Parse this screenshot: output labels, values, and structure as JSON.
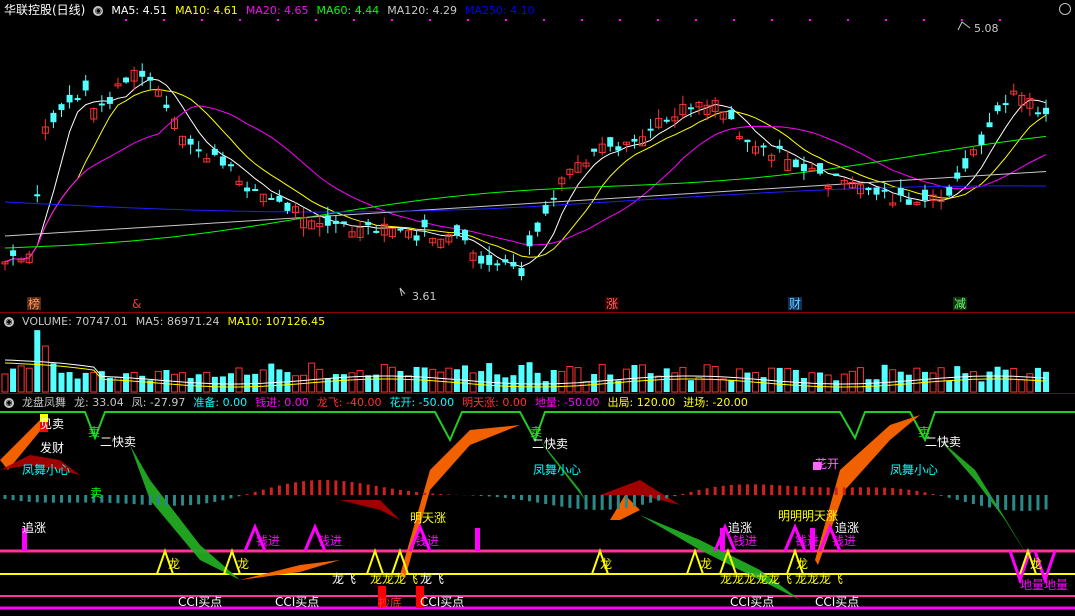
{
  "main_header": {
    "title": "华联控股(日线)",
    "items": [
      {
        "label": "MA5: 4.51",
        "color": "#ffffff"
      },
      {
        "label": "MA10: 4.61",
        "color": "#ffff00"
      },
      {
        "label": "MA20: 4.65",
        "color": "#ff00ff"
      },
      {
        "label": "MA60: 4.44",
        "color": "#00ff00"
      },
      {
        "label": "MA120: 4.29",
        "color": "#c8c8c8"
      },
      {
        "label": "MA250: 4.10",
        "color": "#0000ff"
      }
    ]
  },
  "volume_header": {
    "items": [
      {
        "label": "VOLUME: 70747.01",
        "color": "#c8c8c8"
      },
      {
        "label": "MA5: 86971.24",
        "color": "#c8c8c8"
      },
      {
        "label": "MA10: 107126.45",
        "color": "#ffff00"
      }
    ]
  },
  "indicator_header": {
    "items": [
      {
        "label": "龙盘凤舞",
        "color": "#c8c8c8"
      },
      {
        "label": "龙: 33.04",
        "color": "#c8c8c8"
      },
      {
        "label": "凤: -27.97",
        "color": "#c8c8c8"
      },
      {
        "label": "准备: 0.00",
        "color": "#00ffff"
      },
      {
        "label": "钱进: 0.00",
        "color": "#ff00ff"
      },
      {
        "label": "龙飞: -40.00",
        "color": "#ff3333"
      },
      {
        "label": "花开: -50.00",
        "color": "#00ffff"
      },
      {
        "label": "明天涨: 0.00",
        "color": "#ff3333"
      },
      {
        "label": "地量: -50.00",
        "color": "#ff00ff"
      },
      {
        "label": "出局: 120.00",
        "color": "#ffff00"
      },
      {
        "label": "进场: -20.00",
        "color": "#ffff00"
      }
    ]
  },
  "chart_data": [
    {
      "type": "candlestick",
      "title": "华联控股(日线)",
      "high_label": "5.08",
      "low_label": "3.61",
      "events": [
        {
          "text": "榜",
          "color": "#ff9966",
          "bg": "#5a2a10"
        },
        {
          "text": "&",
          "color": "#ff3333",
          "bg": ""
        },
        {
          "text": "涨",
          "color": "#ff6666",
          "bg": "#3a0000"
        },
        {
          "text": "财",
          "color": "#66ccff",
          "bg": "#10305a"
        },
        {
          "text": "减",
          "color": "#66ff66",
          "bg": "#103010"
        }
      ]
    },
    {
      "type": "bar",
      "title": "VOLUME"
    },
    {
      "type": "area",
      "title": "龙盘凤舞",
      "annotations": [
        {
          "text": "见卖",
          "color": "#ffffff"
        },
        {
          "text": "发财",
          "color": "#ffffff"
        },
        {
          "text": "凤舞小心",
          "color": "#00ffff"
        },
        {
          "text": "卖",
          "color": "#00ff00"
        },
        {
          "text": "二快卖",
          "color": "#ffffff"
        },
        {
          "text": "卖",
          "color": "#00ff00"
        },
        {
          "text": "追涨",
          "color": "#ffffff"
        },
        {
          "text": "钱进",
          "color": "#ff00ff"
        },
        {
          "text": "钱进",
          "color": "#ff00ff"
        },
        {
          "text": "龙",
          "color": "#ffff00"
        },
        {
          "text": "龙",
          "color": "#ffff00"
        },
        {
          "text": "CCI买点",
          "color": "#ffffff"
        },
        {
          "text": "CCI买点",
          "color": "#ffffff"
        },
        {
          "text": "龙飞",
          "color": "#ffffff"
        },
        {
          "text": "龙龙龙飞",
          "color": "#ffff00"
        },
        {
          "text": "龙飞",
          "color": "#ffffff"
        },
        {
          "text": "钱进",
          "color": "#ff00ff"
        },
        {
          "text": "明天涨",
          "color": "#ffff00"
        },
        {
          "text": "抄底",
          "color": "#ff3333"
        },
        {
          "text": "CCI买点",
          "color": "#ffffff"
        },
        {
          "text": "卖",
          "color": "#00ff00"
        },
        {
          "text": "二快卖",
          "color": "#ffffff"
        },
        {
          "text": "凤舞小心",
          "color": "#00ffff"
        },
        {
          "text": "追涨",
          "color": "#ffffff"
        },
        {
          "text": "钱进",
          "color": "#ff00ff"
        },
        {
          "text": "龙",
          "color": "#ffff00"
        },
        {
          "text": "龙",
          "color": "#ffff00"
        },
        {
          "text": "龙龙龙龙龙飞",
          "color": "#ffff00"
        },
        {
          "text": "CCI买点",
          "color": "#ffffff"
        },
        {
          "text": "明明明天涨",
          "color": "#ffff00"
        },
        {
          "text": "钱进",
          "color": "#ff00ff"
        },
        {
          "text": "龙",
          "color": "#ffff00"
        },
        {
          "text": "龙龙龙飞",
          "color": "#ffff00"
        },
        {
          "text": "CCI买点",
          "color": "#ffffff"
        },
        {
          "text": "花开",
          "color": "#ff66ff"
        },
        {
          "text": "追涨",
          "color": "#ffffff"
        },
        {
          "text": "钱进",
          "color": "#ff00ff"
        },
        {
          "text": "卖",
          "color": "#00ff00"
        },
        {
          "text": "二快卖",
          "color": "#ffffff"
        },
        {
          "text": "凤舞小心",
          "color": "#00ffff"
        },
        {
          "text": "龙",
          "color": "#ffff00"
        },
        {
          "text": "地量地量",
          "color": "#ff00ff"
        }
      ]
    }
  ]
}
